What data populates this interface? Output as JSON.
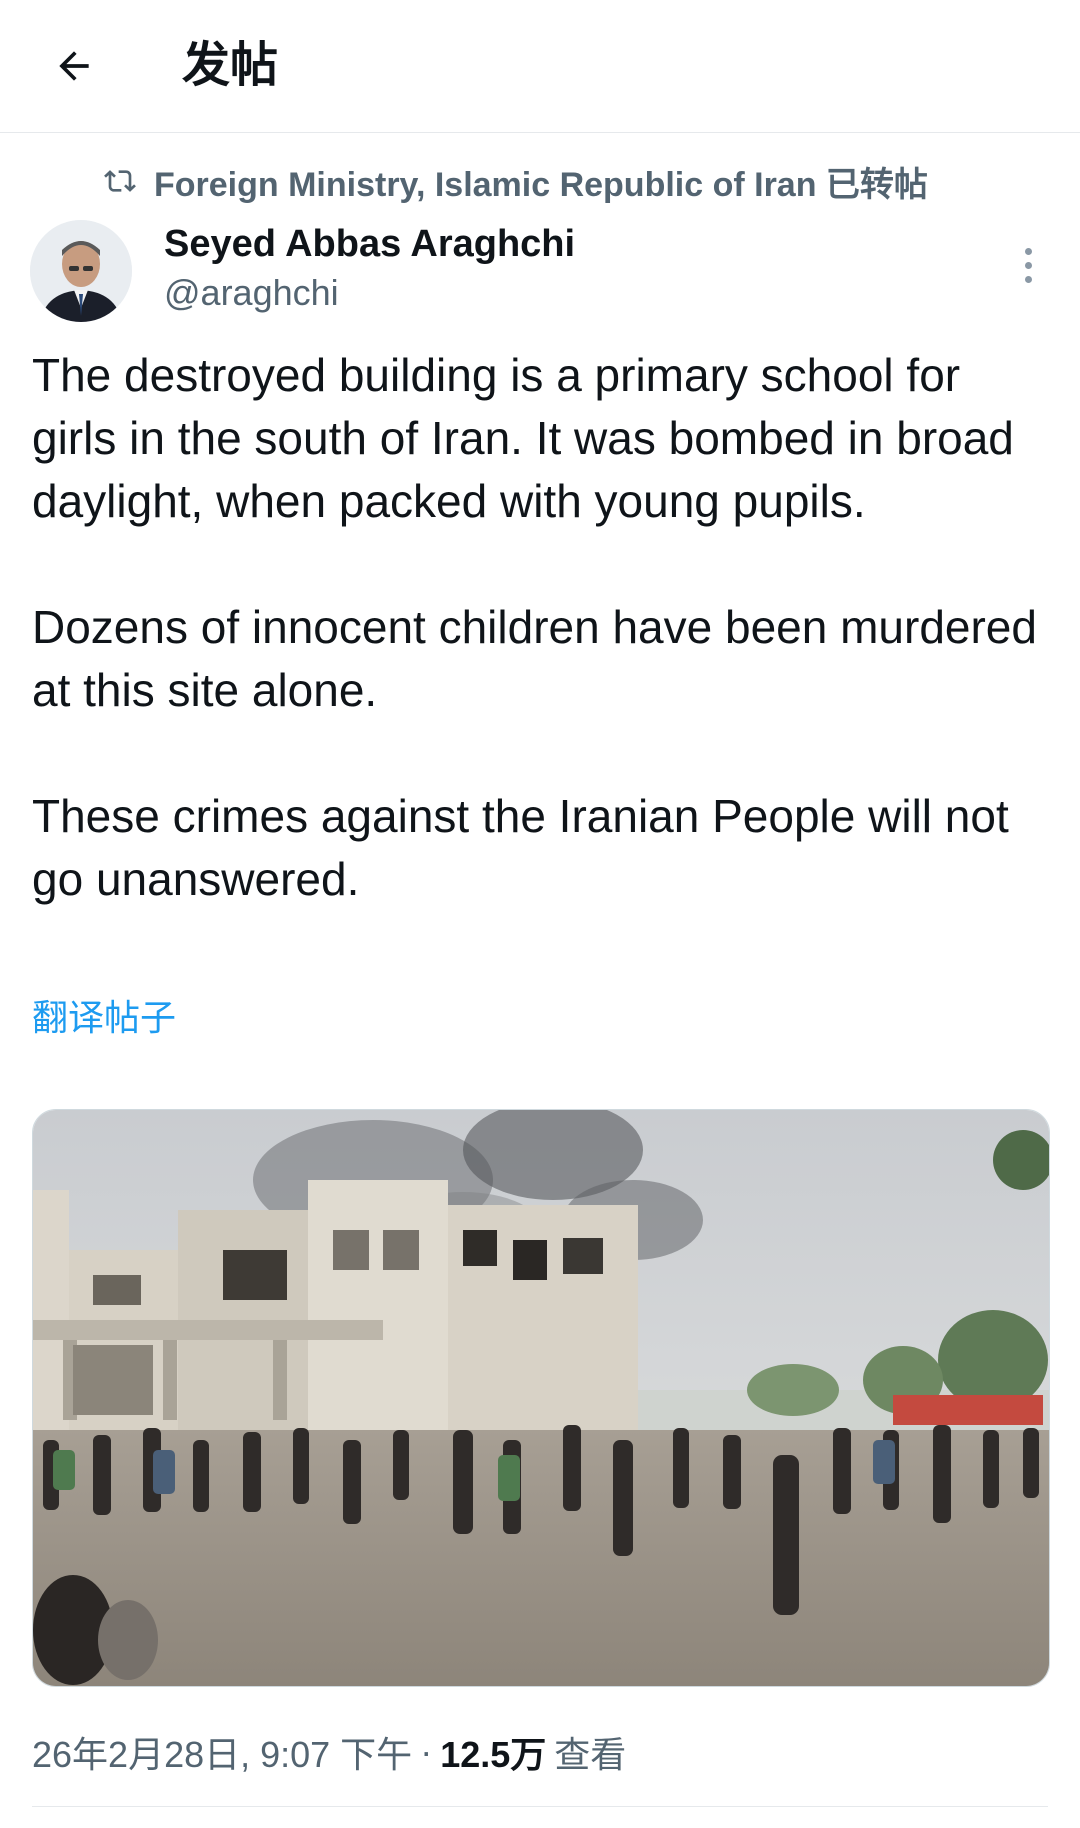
{
  "header": {
    "title": "发帖",
    "back_icon": "back-arrow-icon"
  },
  "tweet": {
    "repost_by": "Foreign Ministry, Islamic Republic of Iran 已转帖",
    "author_name": "Seyed Abbas Araghchi",
    "author_handle": "@araghchi",
    "body": "The destroyed building is a primary school for girls in the south of Iran. It was bombed in broad daylight, when packed with young pupils.\n\nDozens of innocent children have been murdered at this site alone.\n\nThese crimes against the Iranian People will not go unanswered.",
    "translate_label": "翻译帖子",
    "timestamp": "26年2月28日, 9:07 下午",
    "separator": "·",
    "views_count": "12.5万",
    "views_label": "查看"
  },
  "colors": {
    "text_primary": "#0f1419",
    "text_secondary": "#536471",
    "link": "#1d9bf0",
    "divider": "#e6e9ec"
  }
}
